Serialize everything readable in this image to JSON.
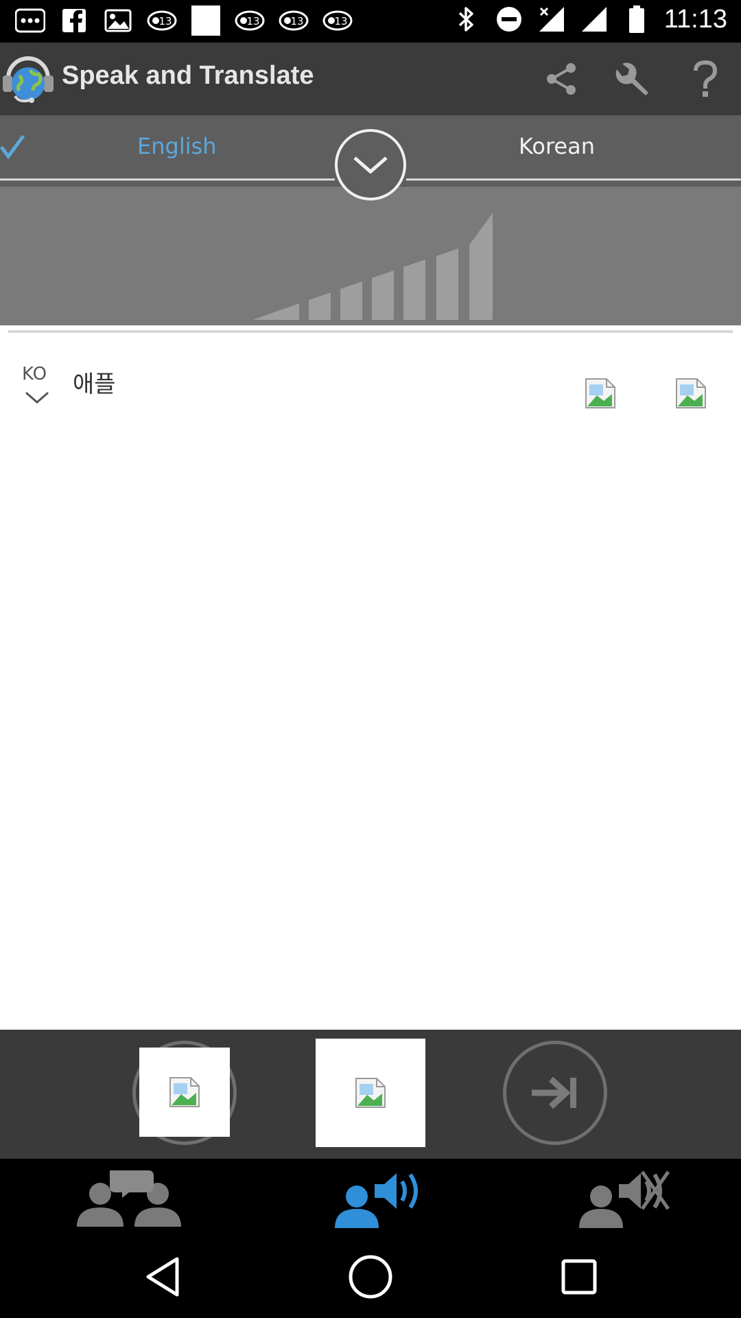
{
  "status_bar": {
    "time": "11:13",
    "left_icons": [
      "more-dots-icon",
      "facebook-icon",
      "gallery-icon",
      "abc13-news-icon",
      "blank-notification-icon",
      "abc13-news-icon",
      "abc13-news-icon",
      "abc13-news-icon"
    ],
    "right_icons": [
      "bluetooth-icon",
      "do-not-disturb-icon",
      "signal-x-icon",
      "signal-icon",
      "battery-icon"
    ]
  },
  "app": {
    "title": "Speak and Translate",
    "header_icons": [
      "share-icon",
      "wrench-icon",
      "help-icon"
    ]
  },
  "languages": {
    "source": "English",
    "target": "Korean",
    "source_selected": true
  },
  "result": {
    "lang_code": "KO",
    "text": "애플"
  },
  "colors": {
    "header_bg": "#3b3b3b",
    "langbar_bg": "#5e5e5e",
    "selected_lang": "#5ba8dc",
    "level_bg": "#7a7a7a",
    "active_mode": "#2f8fd8"
  },
  "controls": {
    "buttons": [
      "microphone-button",
      "speak-button",
      "next-button"
    ]
  },
  "modes": {
    "items": [
      "conversation-mode",
      "voice-output-mode",
      "voice-mute-mode"
    ],
    "active": "voice-output-mode"
  },
  "nav": {
    "items": [
      "back-icon",
      "home-icon",
      "recents-icon"
    ]
  }
}
